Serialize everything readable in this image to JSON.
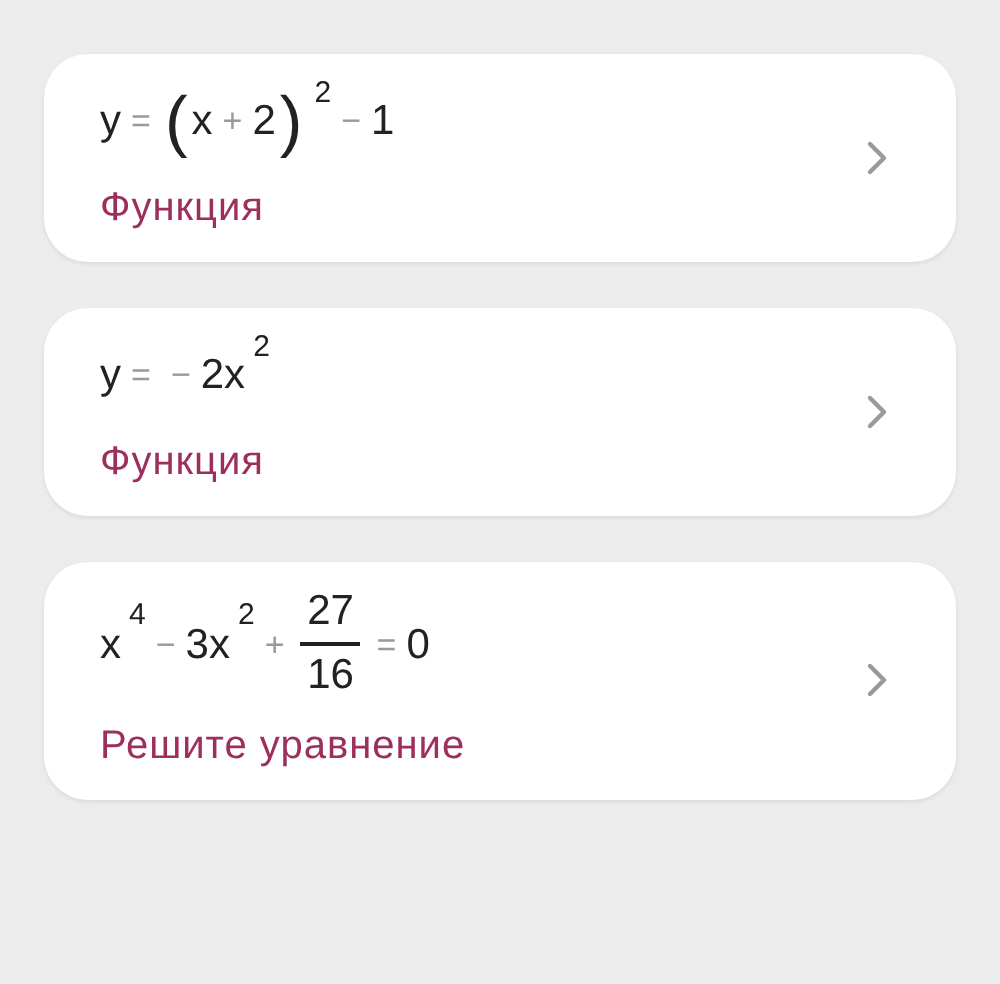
{
  "cards": [
    {
      "formula": [
        {
          "kind": "var",
          "text": "y"
        },
        {
          "kind": "op",
          "text": "="
        },
        {
          "kind": "paren",
          "text": "("
        },
        {
          "kind": "var",
          "text": "x"
        },
        {
          "kind": "op",
          "text": "+"
        },
        {
          "kind": "num",
          "text": "2"
        },
        {
          "kind": "paren",
          "text": ")"
        },
        {
          "kind": "sup",
          "text": "2"
        },
        {
          "kind": "op",
          "text": "−"
        },
        {
          "kind": "num",
          "text": "1"
        }
      ],
      "label": "Функция"
    },
    {
      "formula": [
        {
          "kind": "var",
          "text": "y"
        },
        {
          "kind": "op",
          "text": "="
        },
        {
          "kind": "op",
          "text": "−"
        },
        {
          "kind": "num",
          "text": "2x"
        },
        {
          "kind": "sup",
          "text": "2"
        }
      ],
      "label": "Функция"
    },
    {
      "formula": [
        {
          "kind": "var",
          "text": "x"
        },
        {
          "kind": "sup",
          "text": "4"
        },
        {
          "kind": "op",
          "text": "−"
        },
        {
          "kind": "num",
          "text": "3x"
        },
        {
          "kind": "sup",
          "text": "2"
        },
        {
          "kind": "op",
          "text": "+"
        },
        {
          "kind": "frac",
          "numerator": "27",
          "denominator": "16"
        },
        {
          "kind": "op",
          "text": "="
        },
        {
          "kind": "num",
          "text": "0"
        }
      ],
      "label": "Решите уравнение"
    }
  ]
}
